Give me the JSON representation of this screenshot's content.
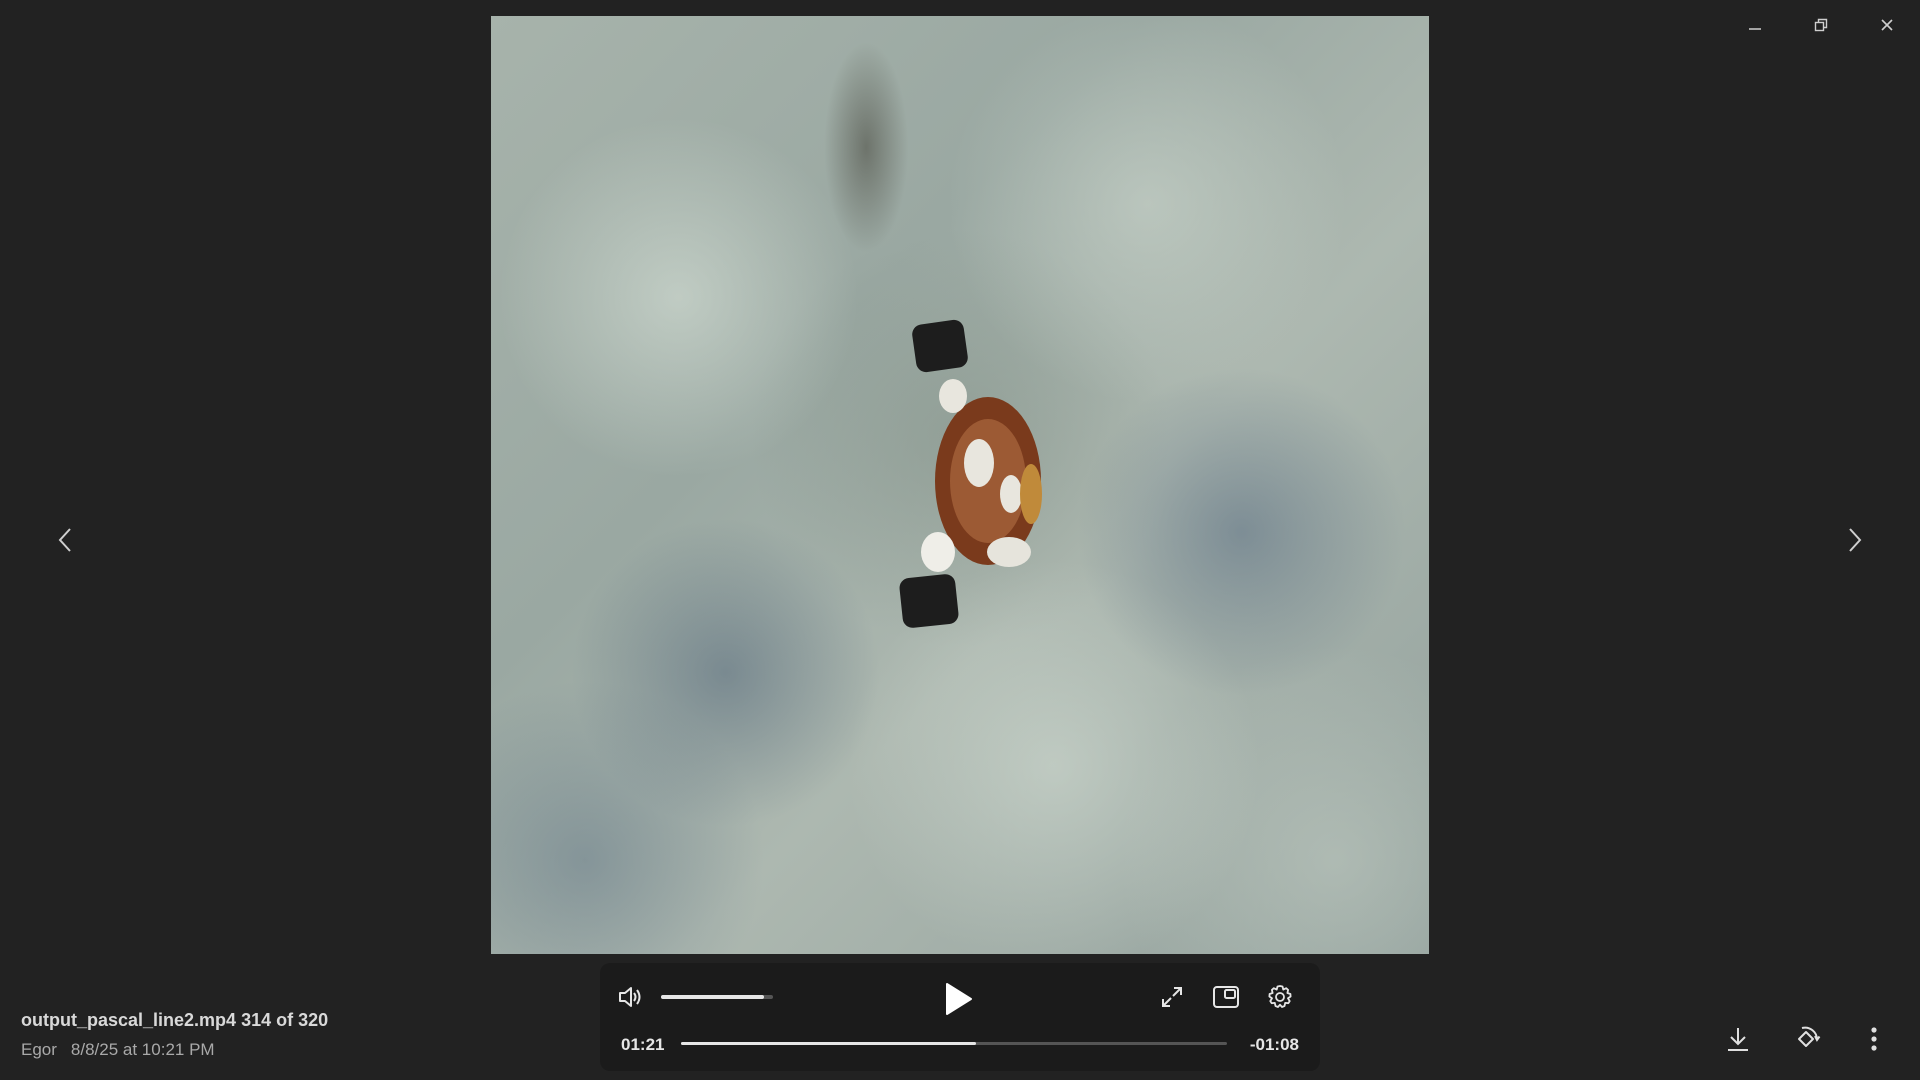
{
  "window": {
    "controls": [
      {
        "name": "minimize-icon"
      },
      {
        "name": "restore-icon"
      },
      {
        "name": "close-icon"
      }
    ]
  },
  "navigation": {
    "prev_icon": "chevron-left-icon",
    "next_icon": "chevron-right-icon"
  },
  "file": {
    "name": "output_pascal_line2.mp4",
    "counter": "314 of 320",
    "author": "Egor",
    "date": "8/8/25 at 10:21 PM"
  },
  "player": {
    "elapsed": "01:21",
    "remaining": "-01:08",
    "progress": 0.54,
    "volume": 0.92,
    "state": "paused",
    "icons": [
      "volume-icon",
      "play-icon",
      "expand-icon",
      "picture-in-picture-icon",
      "gear-icon"
    ]
  },
  "actions": {
    "icons": [
      "download-icon",
      "rotate-icon",
      "more-vertical-icon"
    ]
  },
  "colors": {
    "background": "#222222",
    "player_background": "#1b1b1b",
    "foreground": "#e6e6e6",
    "muted_text": "#a9a9a9"
  }
}
